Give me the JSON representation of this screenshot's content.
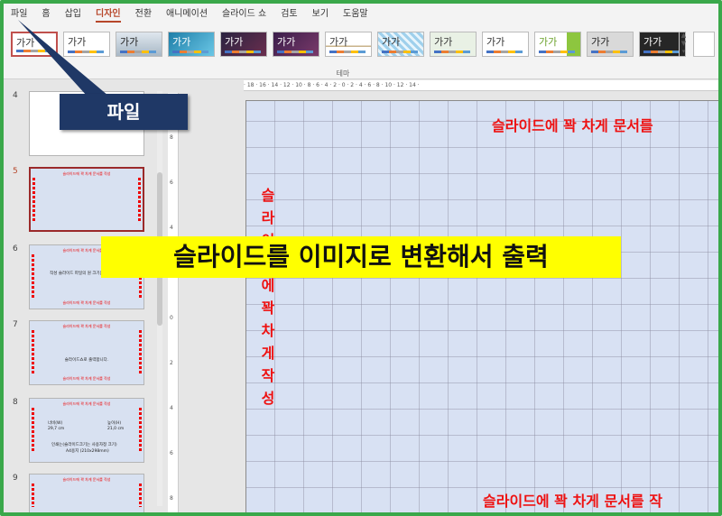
{
  "ribbon": {
    "tabs": [
      "파일",
      "홈",
      "삽입",
      "디자인",
      "전환",
      "애니메이션",
      "슬라이드 쇼",
      "검토",
      "보기",
      "도움말"
    ],
    "active_tab": "디자인",
    "gallery_label": "테마",
    "theme_sample_text": "가가",
    "more_button": "▲\n▼"
  },
  "slides_panel": {
    "slide_numbers": [
      "4",
      "5",
      "6",
      "7",
      "8",
      "9"
    ],
    "slide_title": "슬라이드에 꽉 차게 문서를 작성",
    "slide6_body": "작성 슬라이드 파일의 원 크기는 사진입니다",
    "slide7_body": "슬라이드쇼로 출력합니다.",
    "slide8": {
      "left_top": "너비(W)",
      "left_bottom": "29,7 cm",
      "right_top": "높이(H)",
      "right_bottom": "21,0 cm",
      "line1": "인쇄는(슬라이드크기는 사용자정 크기)",
      "line2": "A4용지 (210x298mm)"
    }
  },
  "ruler": {
    "horizontal": "· 18 · 16 · 14 · 12 · 10 · 8 · 6 · 4 · 2 · 0 · 2 · 4 · 6 · 8 · 10 · 12 · 14 ·",
    "vertical": [
      "8",
      "6",
      "4",
      "2",
      "0",
      "2",
      "4",
      "6",
      "8"
    ]
  },
  "slide": {
    "top_text": "슬라이드에 꽉 차게 문서를",
    "bottom_text": "슬라이드에 꽉 차게 문서를 작",
    "vertical_text": "슬라이드에꽉차게작성"
  },
  "annotations": {
    "callout": "파일",
    "banner": "슬라이드를 이미지로 변환해서 출력"
  },
  "colors": {
    "frame": "#3aa84a",
    "active_tab": "#b7472a",
    "slide_text": "#ee1111",
    "callout_bg": "#1f3866",
    "banner_bg": "#ffff00"
  }
}
